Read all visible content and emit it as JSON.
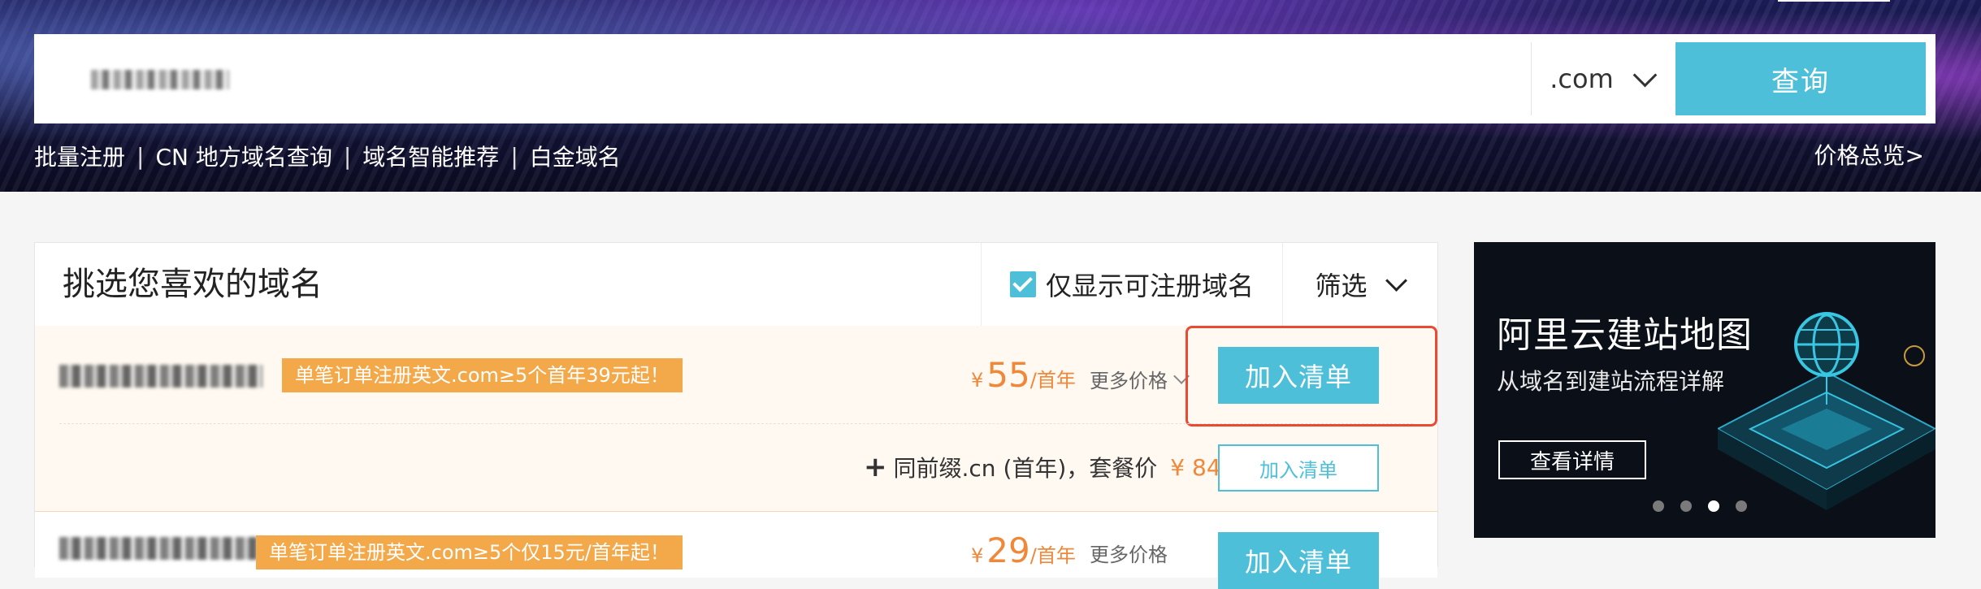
{
  "search": {
    "query": "",
    "suffix": ".com",
    "button_label": "查询"
  },
  "quick_links": {
    "items": [
      "批量注册",
      "CN 地方域名查询",
      "域名智能推荐",
      "白金域名"
    ],
    "separator": "|"
  },
  "price_overview": "价格总览>",
  "panel": {
    "title": "挑选您喜欢的域名",
    "filter_checkbox_label": "仅显示可注册域名",
    "filter_checkbox_checked": true,
    "filter_button": "筛选"
  },
  "results": [
    {
      "promo": "单笔订单注册英文.com≥5个首年39元起！",
      "price_currency": "¥",
      "price": "55",
      "price_unit": "/首年",
      "more_price": "更多价格",
      "add_label": "加入清单",
      "bundle": {
        "text": "同前缀.cn (首年)，套餐价",
        "price": "¥ 84",
        "add_label": "加入清单"
      }
    },
    {
      "promo": "单笔订单注册英文.com≥5个仅15元/首年起！",
      "price_currency": "¥",
      "price": "29",
      "price_unit": "/首年",
      "more_price": "更多价格",
      "add_label": "加入清单"
    }
  ],
  "ad": {
    "title": "阿里云建站地图",
    "subtitle": "从域名到建站流程详解",
    "button": "查看详情",
    "slide_count": 4,
    "active_slide": 3
  },
  "colors": {
    "accent": "#4dbfd9",
    "price": "#f0883a",
    "promo": "#f3a94a",
    "highlight_box": "#e84a33"
  }
}
